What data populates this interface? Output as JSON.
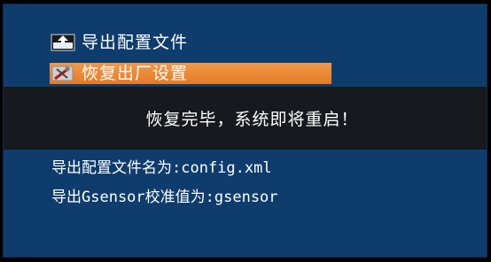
{
  "menu": {
    "items": [
      {
        "label": "导出配置文件",
        "icon": "export-disk-icon"
      },
      {
        "label": "恢复出厂设置",
        "icon": "restore-tools-icon",
        "selected": true
      }
    ]
  },
  "overlay": {
    "message": "恢复完毕，系统即将重启！"
  },
  "info": {
    "config_filename_line": "导出配置文件名为:config.xml",
    "gsensor_filename_line": "导出Gsensor校准值为:gsensor"
  },
  "colors": {
    "background": "#0e3c6c",
    "selection": "#ec8a3a",
    "overlay": "#171717",
    "text": "#ffffff"
  }
}
